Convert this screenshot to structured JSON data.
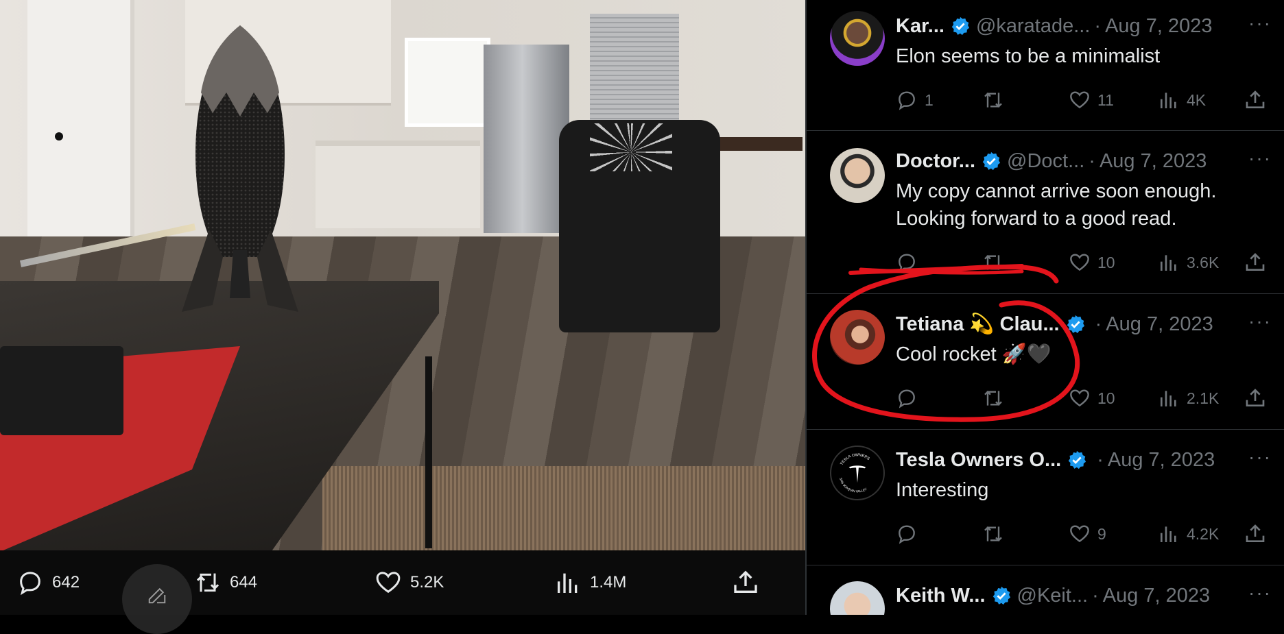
{
  "post_actions": {
    "replies": "642",
    "reposts": "644",
    "likes": "5.2K",
    "views": "1.4M"
  },
  "replies": [
    {
      "name": "Kar...",
      "handle": "@karatade...",
      "date": "Aug 7, 2023",
      "text": "Elon seems to be a minimalist",
      "reply_count": "1",
      "repost_count": "",
      "like_count": "11",
      "views": "4K"
    },
    {
      "name": "Doctor...",
      "handle": "@Doct...",
      "date": "Aug 7, 2023",
      "text": "My copy cannot arrive soon enough. Looking forward to a good read.",
      "reply_count": "",
      "repost_count": "",
      "like_count": "10",
      "views": "3.6K"
    },
    {
      "name": "Tetiana 💫 Clau...",
      "handle": "",
      "date": "Aug 7, 2023",
      "text": "Cool rocket 🚀🖤",
      "reply_count": "",
      "repost_count": "",
      "like_count": "10",
      "views": "2.1K"
    },
    {
      "name": "Tesla Owners O...",
      "handle": "",
      "date": "Aug 7, 2023",
      "text": "Interesting",
      "reply_count": "",
      "repost_count": "",
      "like_count": "9",
      "views": "4.2K"
    },
    {
      "name": "Keith W...",
      "handle": "@Keit...",
      "date": "Aug 7, 2023",
      "text": "",
      "reply_count": "",
      "repost_count": "",
      "like_count": "",
      "views": ""
    }
  ],
  "avatar_logo_text": "TESLA OWNERS · SAN JOAQUIN VALLEY",
  "separator": "·",
  "more_glyph": "···",
  "icons": {
    "reply": "speech-bubble-icon",
    "repost": "repost-arrows-icon",
    "like": "heart-icon",
    "views": "bar-chart-icon",
    "share": "share-upload-icon",
    "verified": "verified-badge-icon",
    "compose": "compose-pen-icon"
  },
  "colors": {
    "background": "#000000",
    "text_primary": "#e7e9ea",
    "text_secondary": "#71767b",
    "verified": "#1d9bf0",
    "divider": "#2f3336",
    "annotation": "#e3141c"
  }
}
